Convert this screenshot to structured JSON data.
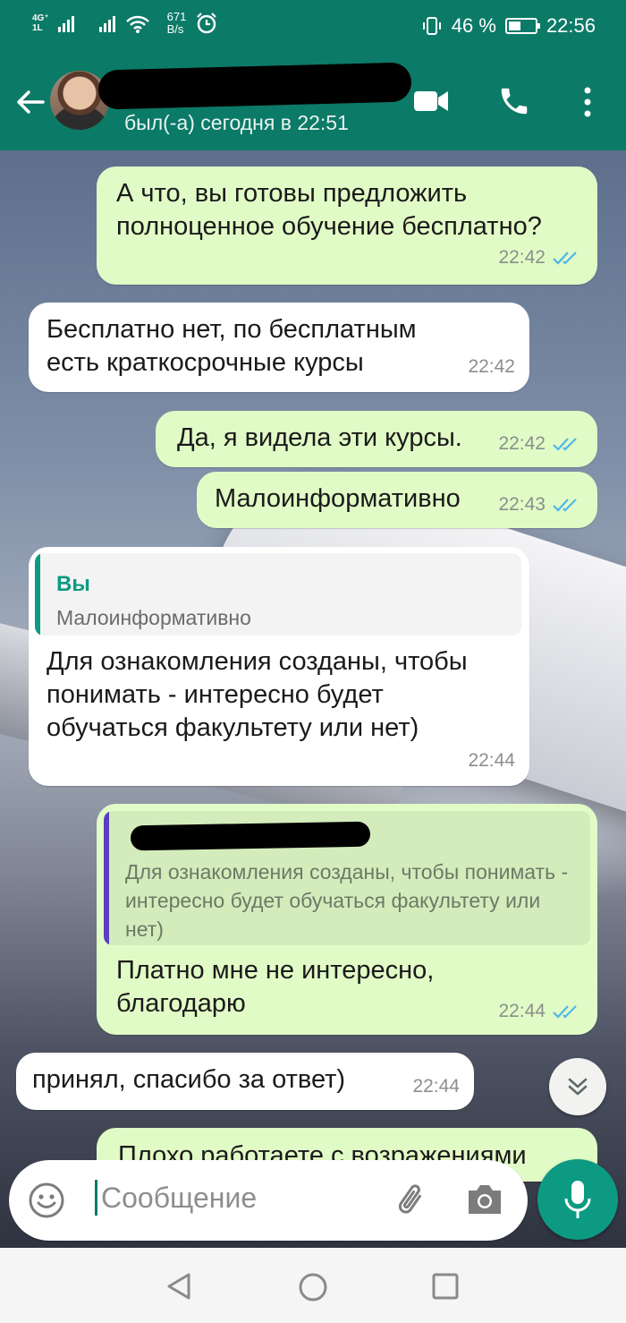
{
  "status_bar": {
    "network_type": "4G⁺",
    "network_sub": "1L",
    "speed_value": "671",
    "speed_unit": "B/s",
    "battery": "46 %",
    "battery_level": 0.46,
    "time": "22:56"
  },
  "header": {
    "last_seen": "был(-а) сегодня в 22:51"
  },
  "messages": [
    {
      "dir": "out",
      "text": "А что, вы готовы предложить полноценное обучение бесплатно?",
      "time": "22:42",
      "read": true
    },
    {
      "dir": "in",
      "text": "Бесплатно нет, по бесплатным есть краткосрочные курсы",
      "time": "22:42"
    },
    {
      "dir": "out",
      "text": "Да, я видела эти курсы.",
      "time": "22:42",
      "read": true
    },
    {
      "dir": "out",
      "text": "Малоинформативно",
      "time": "22:43",
      "read": true
    },
    {
      "dir": "in",
      "quote": {
        "author": "Вы",
        "text": "Малоинформативно"
      },
      "text": "Для ознакомления созданы, чтобы понимать - интересно будет обучаться факультету или нет)",
      "time": "22:44"
    },
    {
      "dir": "out",
      "quote": {
        "author": "",
        "text": "Для ознакомления созданы, чтобы понимать - интересно будет обучаться факультету или нет)"
      },
      "text": "Платно мне не интересно, благодарю",
      "time": "22:44",
      "read": true
    },
    {
      "dir": "in",
      "text": "принял, спасибо за ответ)",
      "time": "22:44"
    },
    {
      "dir": "out",
      "text": "Плохо работаете с возражениями",
      "partial": true
    }
  ],
  "composer": {
    "placeholder": "Сообщение"
  },
  "colors": {
    "header": "#0b7a67",
    "outgoing_bubble": "#e1fbc6",
    "incoming_bubble": "#ffffff",
    "read_ticks": "#4fb6ec",
    "quote_author_in": "#0d9a83",
    "quote_bar_out": "#5a3fc2",
    "mic_button": "#0d9a83"
  },
  "icons": {
    "back": "arrow-left-icon",
    "video": "video-call-icon",
    "call": "phone-icon",
    "menu": "more-vertical-icon",
    "emoji": "emoji-icon",
    "attach": "paperclip-icon",
    "camera": "camera-icon",
    "mic": "microphone-icon",
    "scroll": "double-chevron-down-icon"
  }
}
